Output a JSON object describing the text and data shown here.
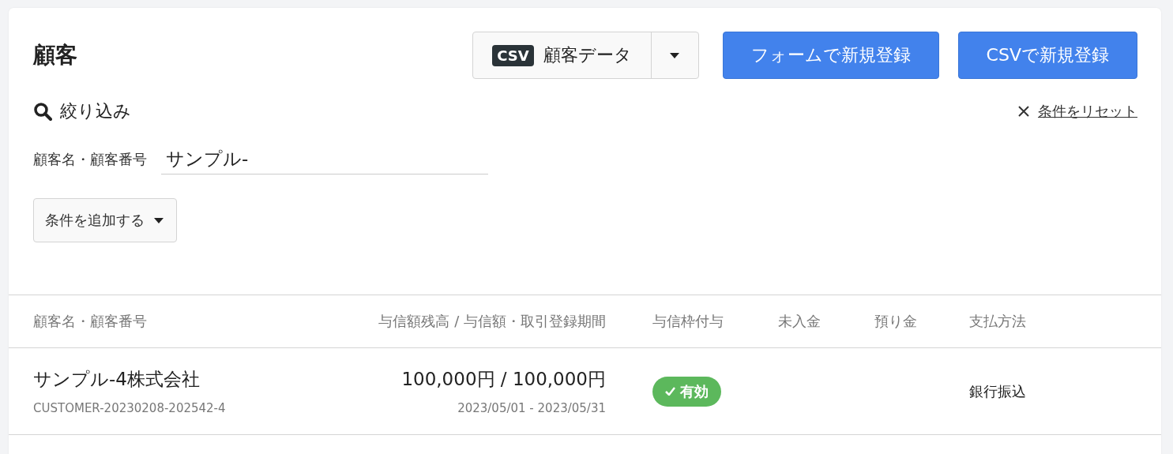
{
  "page_title": "顧客",
  "csv_download": {
    "badge": "CSV",
    "label": "顧客データ"
  },
  "buttons": [
    "フォームで新規登録",
    "CSVで新規登録"
  ],
  "filter": {
    "title": "絞り込み",
    "reset": "条件をリセット",
    "field_label": "顧客名・顧客番号",
    "field_value": "サンプル-",
    "add_condition": "条件を追加する"
  },
  "table": {
    "columns": [
      "顧客名・顧客番号",
      "与信額残高 / 与信額・取引登録期間",
      "与信枠付与",
      "未入金",
      "預り金",
      "支払方法"
    ],
    "rows": [
      {
        "name": "サンプル-4株式会社",
        "number": "CUSTOMER-20230208-202542-4",
        "credit": "100,000円 / 100,000円",
        "period": "2023/05/01 - 2023/05/31",
        "credit_status": {
          "label": "有効",
          "active": true
        },
        "payment": "銀行振込"
      }
    ]
  }
}
